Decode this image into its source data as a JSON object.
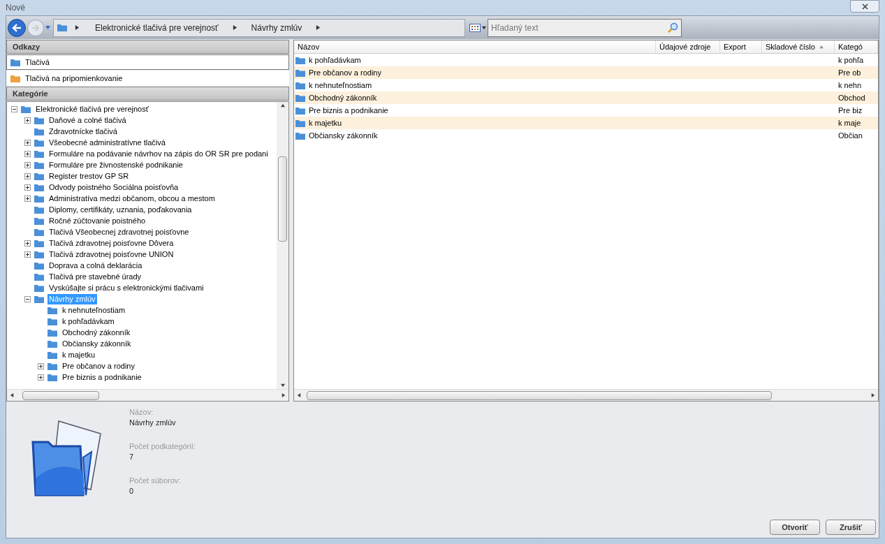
{
  "window": {
    "title": "Nové"
  },
  "breadcrumb": [
    "Elektronické tlačivá pre verejnosť",
    "Návrhy zmlúv"
  ],
  "search": {
    "placeholder": "Hľadaný text"
  },
  "links": {
    "title": "Odkazy",
    "items": [
      {
        "label": "Tlačivá",
        "color": "#4a90d9",
        "selected": true
      },
      {
        "label": "Tlačivá na pripomienkovanie",
        "color": "#f0a040",
        "selected": false
      }
    ]
  },
  "categories": {
    "title": "Kategórie",
    "tree": [
      {
        "label": "Elektronické tlačivá pre verejnosť",
        "expandable": true,
        "expanded": true,
        "selected": false,
        "children": [
          {
            "label": "Daňové a colné tlačivá",
            "expandable": true,
            "expanded": false,
            "selected": false
          },
          {
            "label": "Zdravotnícke tlačivá",
            "expandable": false,
            "expanded": false,
            "selected": false
          },
          {
            "label": "Všeobecné administratívne tlačivá",
            "expandable": true,
            "expanded": false,
            "selected": false
          },
          {
            "label": "Formuláre na podávanie návrhov na zápis do OR SR pre podani",
            "expandable": true,
            "expanded": false,
            "selected": false
          },
          {
            "label": "Formuláre pre živnostenské podnikanie",
            "expandable": true,
            "expanded": false,
            "selected": false
          },
          {
            "label": "Register trestov GP SR",
            "expandable": true,
            "expanded": false,
            "selected": false
          },
          {
            "label": "Odvody poistného Sociálna poisťovňa",
            "expandable": true,
            "expanded": false,
            "selected": false
          },
          {
            "label": "Administratíva medzi občanom, obcou a mestom",
            "expandable": true,
            "expanded": false,
            "selected": false
          },
          {
            "label": "Diplomy, certifikáty, uznania, poďakovania",
            "expandable": false,
            "expanded": false,
            "selected": false
          },
          {
            "label": "Ročné zúčtovanie poistného",
            "expandable": false,
            "expanded": false,
            "selected": false
          },
          {
            "label": "Tlačivá Všeobecnej zdravotnej poisťovne",
            "expandable": false,
            "expanded": false,
            "selected": false
          },
          {
            "label": "Tlačivá zdravotnej poisťovne Dôvera",
            "expandable": true,
            "expanded": false,
            "selected": false
          },
          {
            "label": "Tlačivá zdravotnej poisťovne UNION",
            "expandable": true,
            "expanded": false,
            "selected": false
          },
          {
            "label": "Doprava a colná deklarácia",
            "expandable": false,
            "expanded": false,
            "selected": false
          },
          {
            "label": "Tlačivá pre stavebné úrady",
            "expandable": false,
            "expanded": false,
            "selected": false
          },
          {
            "label": "Vyskúšajte si prácu s elektronickými tlačivami",
            "expandable": false,
            "expanded": false,
            "selected": false
          },
          {
            "label": "Návrhy zmlúv",
            "expandable": true,
            "expanded": true,
            "selected": true,
            "children": [
              {
                "label": "k nehnuteľnostiam",
                "expandable": false,
                "expanded": false,
                "selected": false
              },
              {
                "label": "k pohľadávkam",
                "expandable": false,
                "expanded": false,
                "selected": false
              },
              {
                "label": "Obchodný zákonník",
                "expandable": false,
                "expanded": false,
                "selected": false
              },
              {
                "label": "Občiansky zákonník",
                "expandable": false,
                "expanded": false,
                "selected": false
              },
              {
                "label": "k majetku",
                "expandable": false,
                "expanded": false,
                "selected": false
              },
              {
                "label": "Pre občanov a rodiny",
                "expandable": true,
                "expanded": false,
                "selected": false
              },
              {
                "label": "Pre biznis a podnikanie",
                "expandable": true,
                "expanded": false,
                "selected": false
              }
            ]
          }
        ]
      }
    ]
  },
  "table": {
    "columns": [
      {
        "label": "Názov",
        "sorted": false
      },
      {
        "label": "Údajové zdroje",
        "sorted": false
      },
      {
        "label": "Export",
        "sorted": false
      },
      {
        "label": "Skladové číslo",
        "sorted": true
      },
      {
        "label": "Kategó",
        "sorted": false
      }
    ],
    "rows": [
      {
        "name": "k pohľadávkam",
        "column_5": "k pohľa"
      },
      {
        "name": "Pre občanov a rodiny",
        "column_5": "Pre ob"
      },
      {
        "name": "k nehnuteľnostiam",
        "column_5": "k nehn"
      },
      {
        "name": "Obchodný zákonník",
        "column_5": "Obchod"
      },
      {
        "name": "Pre biznis a podnikanie",
        "column_5": "Pre biz"
      },
      {
        "name": "k majetku",
        "column_5": "k maje"
      },
      {
        "name": "Občiansky zákonník",
        "column_5": "Občian"
      }
    ]
  },
  "details": [
    {
      "label": "Názov:",
      "value": "Návrhy zmlúv"
    },
    {
      "label": "Počet podkategórií:",
      "value": "7"
    },
    {
      "label": "Počet súborov:",
      "value": "0"
    }
  ],
  "buttons": [
    "Otvoriť",
    "Zrušiť"
  ]
}
